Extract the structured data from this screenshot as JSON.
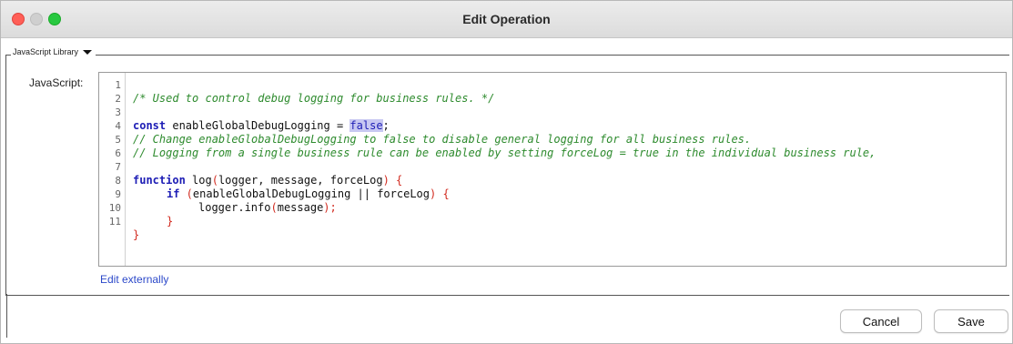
{
  "window": {
    "title": "Edit Operation"
  },
  "group": {
    "label": "JavaScript Library"
  },
  "field": {
    "label": "JavaScript:"
  },
  "editor": {
    "line_numbers": [
      "1",
      "2",
      "3",
      "4",
      "5",
      "6",
      "7",
      "8",
      "9",
      "10",
      "11"
    ],
    "line1": "/* Used to control debug logging for business rules. */",
    "line3_kw": "const",
    "line3_name": " enableGlobalDebugLogging = ",
    "line3_value": "false",
    "line3_end": ";",
    "line4": "// Change enableGlobalDebugLogging to false to disable general logging for all business rules.",
    "line5": "// Logging from a single business rule can be enabled by setting forceLog = true in the individual business rule,",
    "line7_kw": "function",
    "line7_name": " log",
    "line7_open": "(",
    "line7_params": "logger, message, forceLog",
    "line7_close": ") {",
    "line8_kw": "if",
    "line8_open": " (",
    "line8_cond": "enableGlobalDebugLogging || forceLog",
    "line8_close": ") {",
    "line9_call": "logger.info",
    "line9_open": "(",
    "line9_arg": "message",
    "line9_close": ");",
    "line10": "}",
    "line11": "}"
  },
  "links": {
    "edit_externally": "Edit externally"
  },
  "buttons": {
    "cancel": "Cancel",
    "save": "Save"
  },
  "colors": {
    "comment": "#2e8b2e",
    "keyword": "#1d1db5",
    "paren": "#d22a1f",
    "link": "#2b48c9",
    "selection": "#c8c8f2"
  }
}
